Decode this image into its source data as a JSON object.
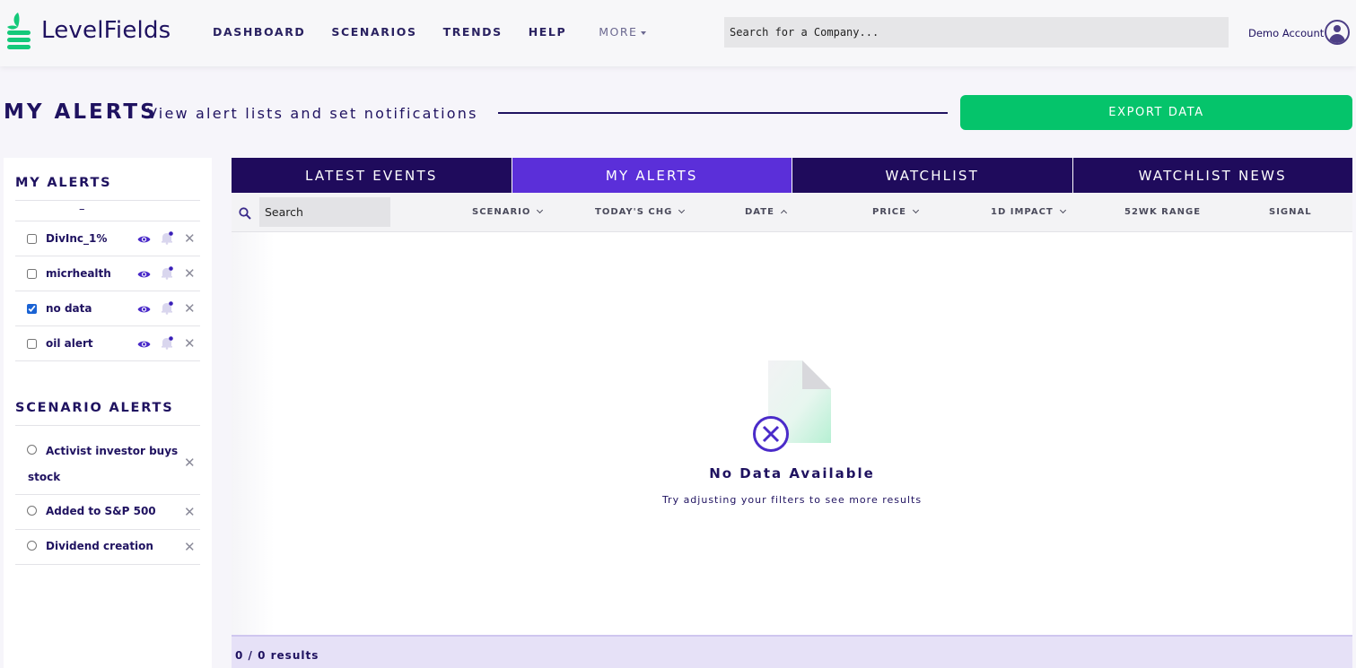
{
  "app": {
    "name": "LevelFields"
  },
  "nav": {
    "items": [
      "DASHBOARD",
      "SCENARIOS",
      "TRENDS",
      "HELP"
    ],
    "more_label": "MORE"
  },
  "search": {
    "placeholder": "Search for a Company..."
  },
  "account": {
    "name": "Demo Account"
  },
  "page": {
    "title": "MY ALERTS",
    "subtitle": "View alert lists and set notifications",
    "export_label": "EXPORT DATA"
  },
  "sidebar": {
    "my_alerts_heading": "MY ALERTS",
    "dash": "–",
    "alerts": [
      {
        "label": "DivInc_1%",
        "checked": false
      },
      {
        "label": "micrhealth",
        "checked": false
      },
      {
        "label": "no data",
        "checked": true
      },
      {
        "label": "oil alert",
        "checked": false
      }
    ],
    "scenario_heading": "SCENARIO ALERTS",
    "scenarios": [
      {
        "label_line1": "Activist investor buys",
        "label_line2": "stock"
      },
      {
        "label_line1": "Added to S&P 500"
      },
      {
        "label_line1": "Dividend creation"
      }
    ]
  },
  "tabs": [
    {
      "label": "LATEST EVENTS",
      "active": false
    },
    {
      "label": "MY ALERTS",
      "active": true
    },
    {
      "label": "WATCHLIST",
      "active": false
    },
    {
      "label": "WATCHLIST NEWS",
      "active": false
    }
  ],
  "table": {
    "search_placeholder": "Search",
    "columns": {
      "scenario": "SCENARIO",
      "todays_chg": "TODAY'S CHG",
      "date": "DATE",
      "price": "PRICE",
      "impact": "1D IMPACT",
      "range": "52WK RANGE",
      "signal": "SIGNAL"
    },
    "empty_title": "No Data Available",
    "empty_subtitle": "Try adjusting your filters to see more results",
    "results": "0 / 0 results"
  },
  "colors": {
    "brand_dark": "#1f0b5c",
    "tab_active": "#5b2fd9",
    "export_green": "#05c46b",
    "logo_green": "#14c97a"
  }
}
